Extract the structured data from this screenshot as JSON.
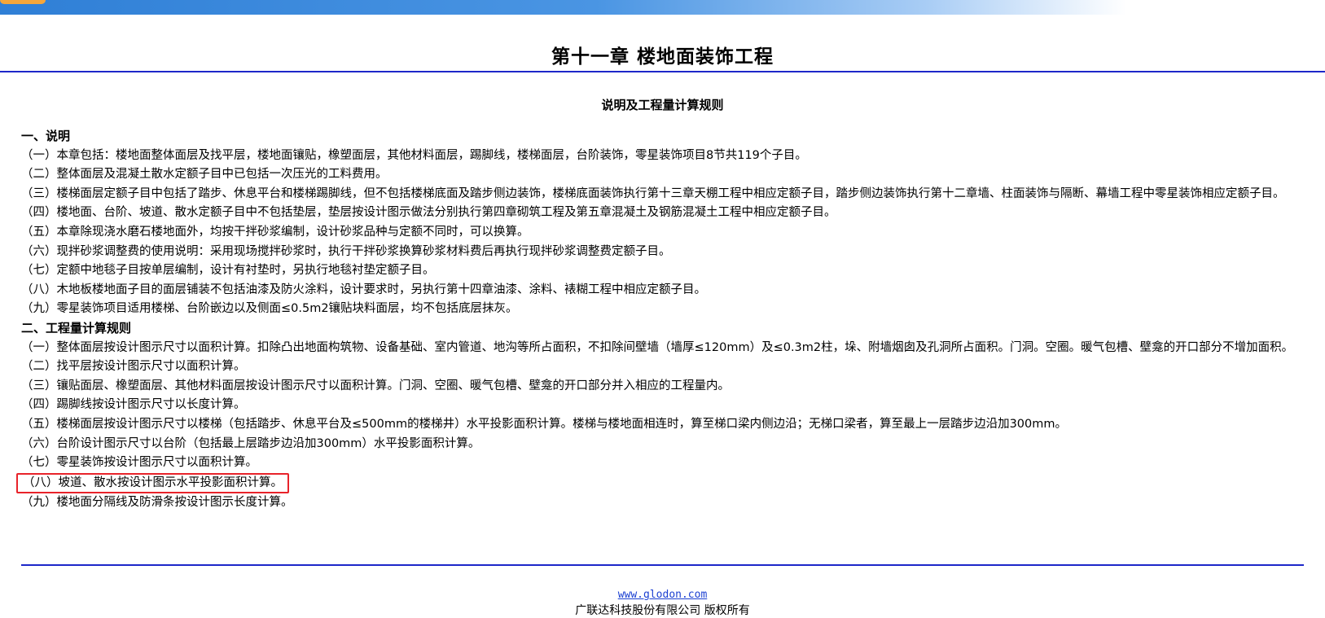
{
  "header": {
    "title": "第十一章  楼地面装饰工程"
  },
  "subtitle": "说明及工程量计算规则",
  "section1": {
    "heading": "一、说明",
    "items": [
      "（一）本章包括：楼地面整体面层及找平层，楼地面镶贴，橡塑面层，其他材料面层，踢脚线，楼梯面层，台阶装饰，零星装饰项目8节共119个子目。",
      "（二）整体面层及混凝土散水定额子目中已包括一次压光的工料费用。",
      "（三）楼梯面层定额子目中包括了踏步、休息平台和楼梯踢脚线，但不包括楼梯底面及踏步侧边装饰，楼梯底面装饰执行第十三章天棚工程中相应定额子目，踏步侧边装饰执行第十二章墙、柱面装饰与隔断、幕墙工程中零星装饰相应定额子目。",
      "（四）楼地面、台阶、坡道、散水定额子目中不包括垫层，垫层按设计图示做法分别执行第四章砌筑工程及第五章混凝土及钢筋混凝土工程中相应定额子目。",
      "（五）本章除现浇水磨石楼地面外，均按干拌砂浆编制，设计砂浆品种与定额不同时，可以换算。",
      "（六）现拌砂浆调整费的使用说明：采用现场搅拌砂浆时，执行干拌砂浆换算砂浆材料费后再执行现拌砂浆调整费定额子目。",
      "（七）定额中地毯子目按单层编制，设计有衬垫时，另执行地毯衬垫定额子目。",
      "（八）木地板楼地面子目的面层铺装不包括油漆及防火涂料，设计要求时，另执行第十四章油漆、涂料、裱糊工程中相应定额子目。",
      "（九）零星装饰项目适用楼梯、台阶嵌边以及侧面≤0.5m2镶贴块料面层，均不包括底层抹灰。"
    ]
  },
  "section2": {
    "heading": "二、工程量计算规则",
    "items": [
      "（一）整体面层按设计图示尺寸以面积计算。扣除凸出地面构筑物、设备基础、室内管道、地沟等所占面积，不扣除间壁墙（墙厚≤120mm）及≤0.3m2柱，垛、附墙烟囱及孔洞所占面积。门洞。空圈。暖气包槽、壁龛的开口部分不增加面积。",
      "（二）找平层按设计图示尺寸以面积计算。",
      "（三）镶贴面层、橡塑面层、其他材料面层按设计图示尺寸以面积计算。门洞、空圈、暖气包槽、壁龛的开口部分并入相应的工程量内。",
      "（四）踢脚线按设计图示尺寸以长度计算。",
      "（五）楼梯面层按设计图示尺寸以楼梯（包括踏步、休息平台及≤500mm的楼梯井）水平投影面积计算。楼梯与楼地面相连时，算至梯口梁内侧边沿；无梯口梁者，算至最上一层踏步边沿加300mm。",
      "（六）台阶设计图示尺寸以台阶（包括最上层踏步边沿加300mm）水平投影面积计算。",
      "（七）零星装饰按设计图示尺寸以面积计算。",
      "（八）坡道、散水按设计图示水平投影面积计算。",
      "（九）楼地面分隔线及防滑条按设计图示长度计算。"
    ]
  },
  "footer": {
    "link": "www.glodon.com",
    "copyright": "广联达科技股份有限公司 版权所有"
  },
  "colors": {
    "rule": "#1d27c9",
    "highlight_border": "#e8232a",
    "link": "#1a3fd1"
  }
}
